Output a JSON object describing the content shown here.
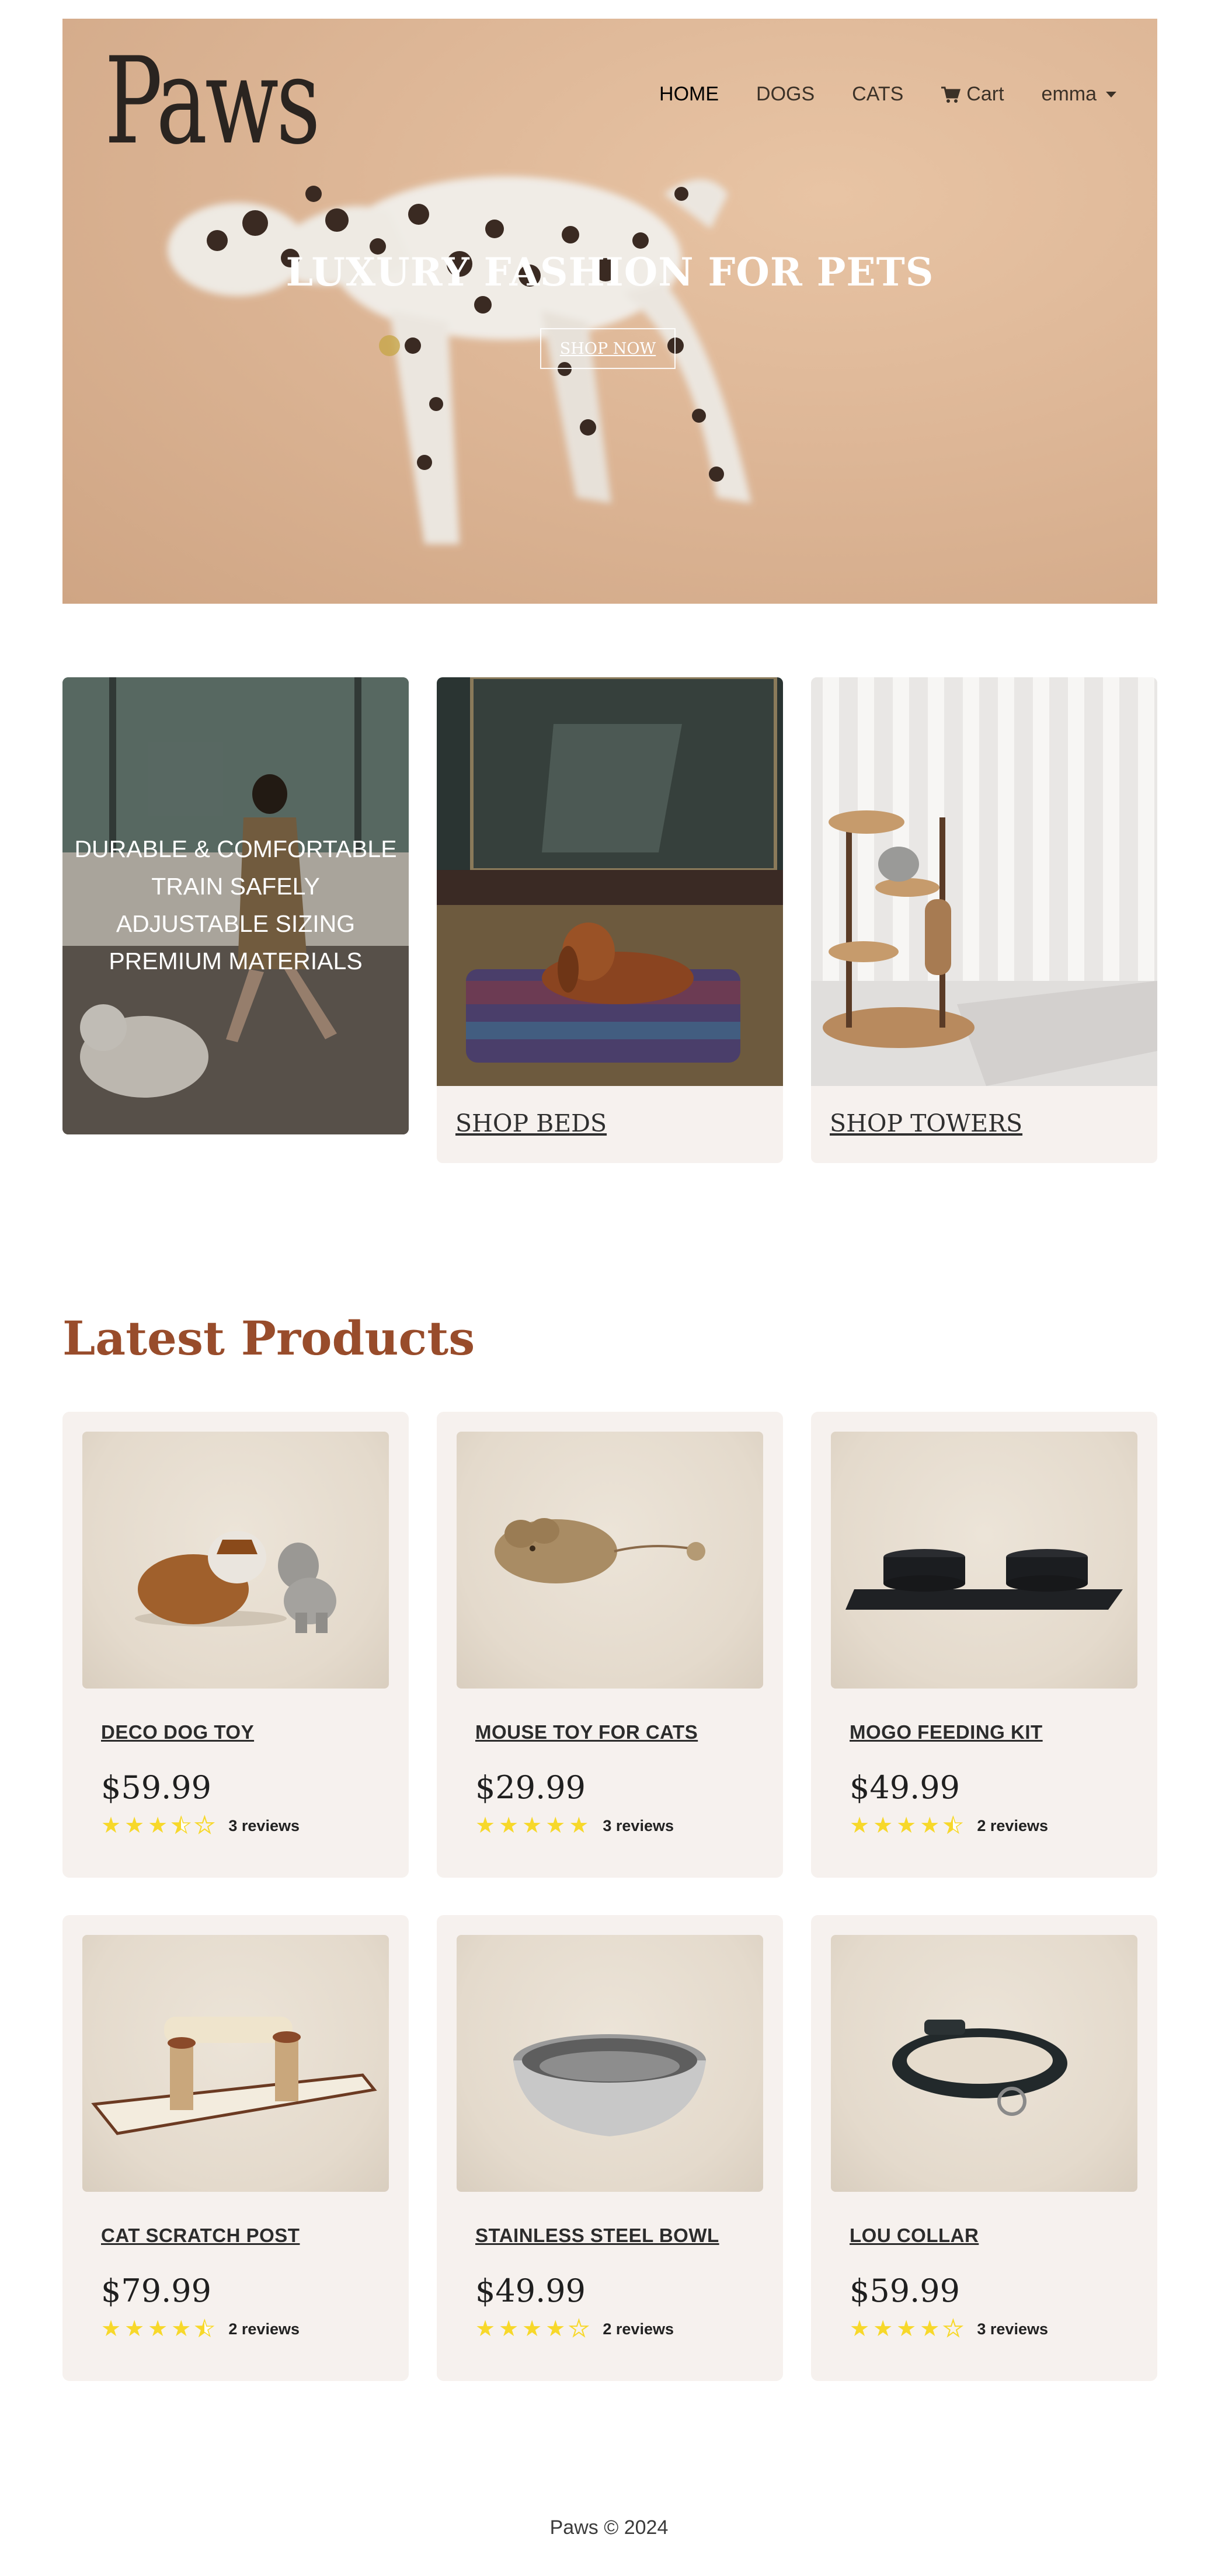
{
  "brand": {
    "logo": "Paws"
  },
  "nav": {
    "home": "HOME",
    "dogs": "DOGS",
    "cats": "CATS",
    "cart": "Cart",
    "user": "emma"
  },
  "hero": {
    "title": "LUXURY FASHION FOR PETS",
    "button": "SHOP NOW"
  },
  "categories": {
    "feature_lines": [
      "DURABLE & COMFORTABLE",
      "TRAIN SAFELY",
      "ADJUSTABLE SIZING",
      "PREMIUM MATERIALS"
    ],
    "beds_link": "SHOP BEDS",
    "towers_link": "SHOP TOWERS"
  },
  "latest": {
    "heading": "Latest Products",
    "products": [
      {
        "name": "DECO DOG TOY",
        "price": "$59.99",
        "rating": 3.5,
        "reviews": "3 reviews"
      },
      {
        "name": "MOUSE TOY FOR CATS",
        "price": "$29.99",
        "rating": 5,
        "reviews": "3 reviews"
      },
      {
        "name": "MOGO FEEDING KIT",
        "price": "$49.99",
        "rating": 4.5,
        "reviews": "2 reviews"
      },
      {
        "name": "CAT SCRATCH POST",
        "price": "$79.99",
        "rating": 4.5,
        "reviews": "2 reviews"
      },
      {
        "name": "STAINLESS STEEL BOWL",
        "price": "$49.99",
        "rating": 4,
        "reviews": "2 reviews"
      },
      {
        "name": "LOU COLLAR",
        "price": "$59.99",
        "rating": 4,
        "reviews": "3 reviews"
      }
    ]
  },
  "footer": {
    "text": "Paws © 2024"
  },
  "colors": {
    "accent": "#984c2b",
    "card_bg": "#f6f1ee",
    "star": "#f7d82a"
  }
}
